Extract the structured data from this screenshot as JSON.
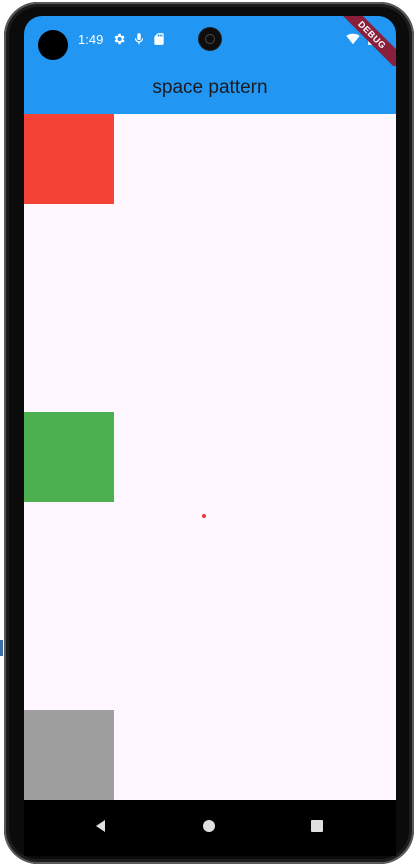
{
  "status_bar": {
    "time": "1:49",
    "icons": [
      "settings-icon",
      "microphone-icon",
      "sd-card-icon",
      "wifi-icon",
      "battery-icon"
    ],
    "debug_banner": "DEBUG"
  },
  "app_bar": {
    "title": "space pattern"
  },
  "content": {
    "squares": [
      {
        "name": "red-square",
        "color": "#f44336"
      },
      {
        "name": "green-square",
        "color": "#4caf50"
      },
      {
        "name": "grey-square",
        "color": "#9e9e9e"
      }
    ],
    "marker_color": "#e53935"
  },
  "navigation_bar": {
    "buttons": [
      "back-icon",
      "home-icon",
      "recents-icon"
    ]
  },
  "colors": {
    "primary": "#2196f3",
    "background": "#fef7ff"
  }
}
